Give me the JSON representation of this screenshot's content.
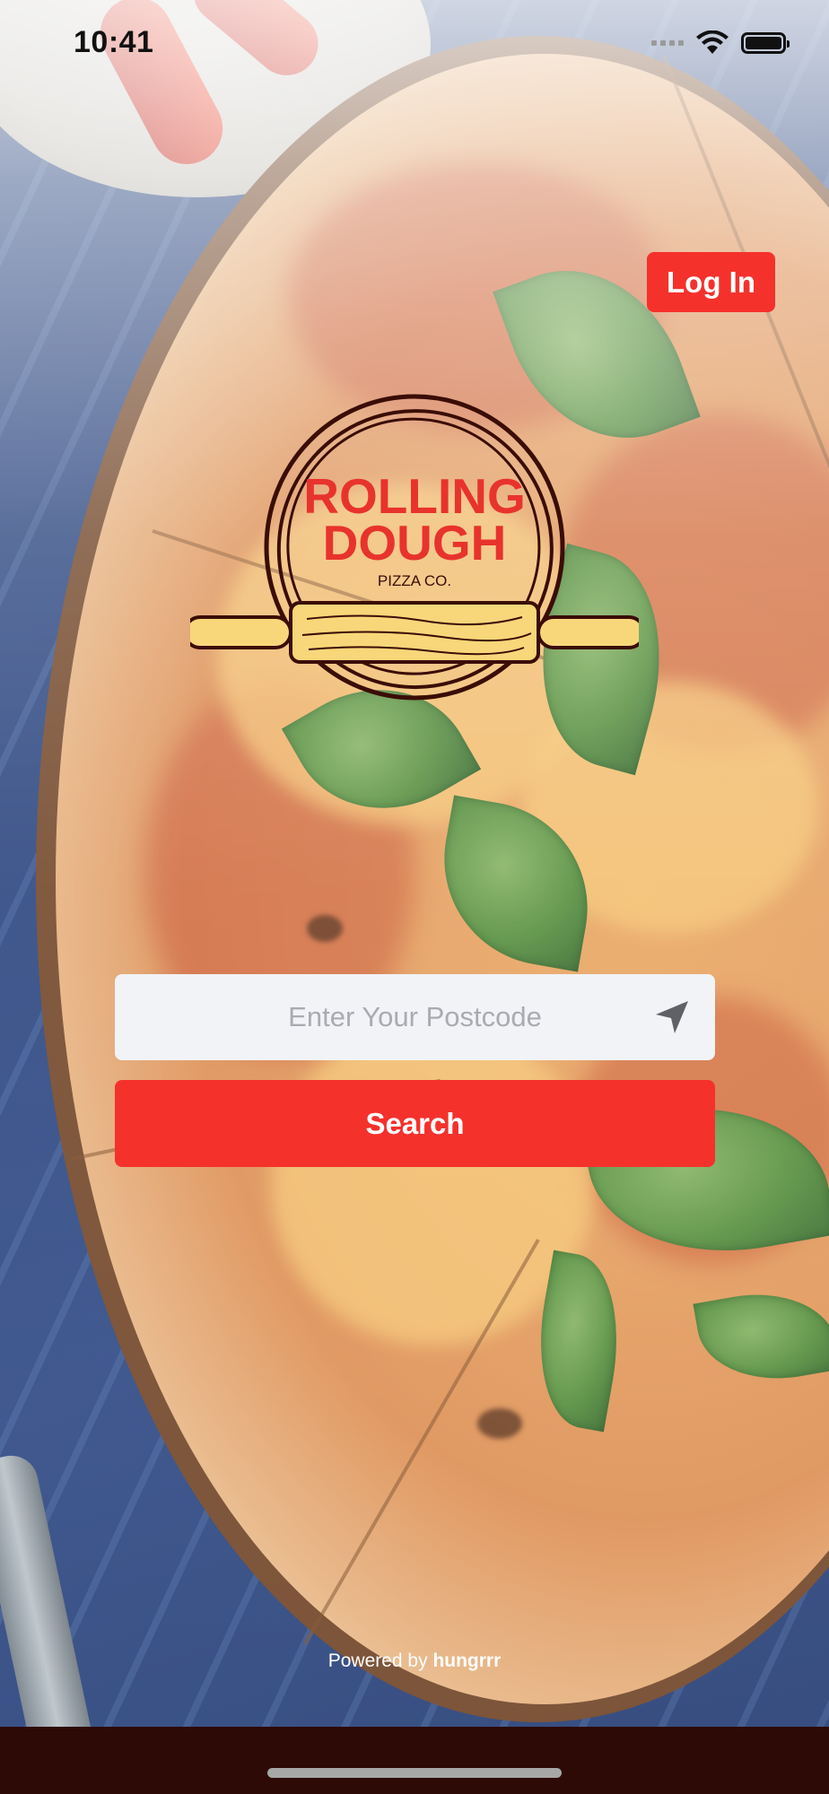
{
  "status_bar": {
    "time": "10:41"
  },
  "header": {
    "login_label": "Log In"
  },
  "logo": {
    "line1": "ROLLING",
    "line2": "DOUGH",
    "tagline": "PIZZA CO."
  },
  "search": {
    "placeholder": "Enter Your Postcode",
    "value": "",
    "button_label": "Search",
    "locate_icon": "location-arrow-icon"
  },
  "footer": {
    "powered_prefix": "Powered by",
    "brand": "hungrrr"
  },
  "colors": {
    "accent": "#f5312c",
    "logo_red": "#e8332c",
    "logo_brown": "#3a0d06",
    "rolling_pin": "#f8d77a",
    "bottom_bar": "#2d0a05"
  }
}
